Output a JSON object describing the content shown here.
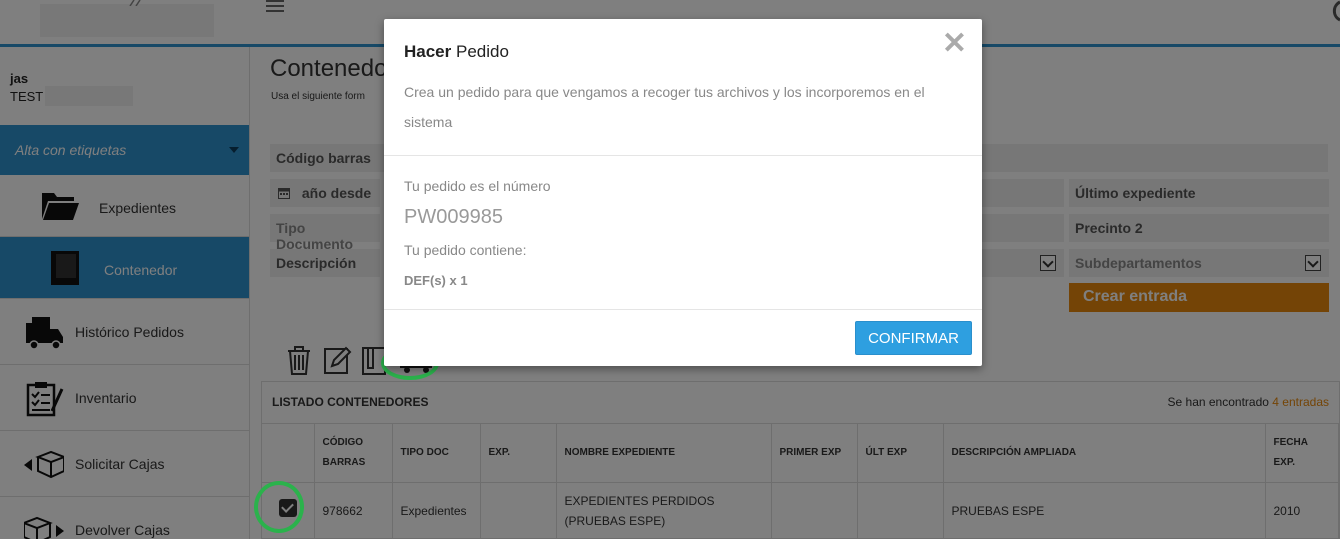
{
  "user": {
    "name": "jas",
    "org": "TEST"
  },
  "sidebar": {
    "section": "Alta con etiquetas",
    "sub_items": [
      {
        "label": "Expedientes",
        "icon": "folder-open-icon"
      },
      {
        "label": "Contenedor",
        "icon": "book-icon",
        "active": true
      }
    ],
    "items": [
      {
        "label": "Histórico Pedidos",
        "icon": "truck-icon"
      },
      {
        "label": "Inventario",
        "icon": "clipboard-icon"
      },
      {
        "label": "Solicitar Cajas",
        "icon": "box-arrow-left-icon"
      },
      {
        "label": "Devolver Cajas",
        "icon": "box-arrow-right-icon"
      }
    ]
  },
  "main": {
    "title": "Contenedo",
    "subtitle": "Usa el siguiente form",
    "form": {
      "codigo_barras": "Código barras",
      "anio_desde": "año desde",
      "ultimo_expediente": "Último expediente",
      "tipo_documento": "Tipo Documento",
      "precinto2": "Precinto 2",
      "descripcion": "Descripción",
      "subdepartamentos": "Subdepartamentos",
      "crear_entrada": "Crear entrada"
    },
    "list": {
      "title": "LISTADO CONTENEDORES",
      "count_prefix": "Se han encontrado",
      "count_value": "4 entradas",
      "columns": [
        "CÓDIGO BARRAS",
        "TIPO DOC",
        "EXP.",
        "NOMBRE EXPEDIENTE",
        "PRIMER EXP",
        "ÚLT EXP",
        "DESCRIPCIÓN AMPLIADA",
        "FECHA EXP."
      ],
      "rows": [
        {
          "codigo": "978662",
          "tipo": "Expedientes",
          "exp": "",
          "nombre": "EXPEDIENTES PERDIDOS (PRUEBAS ESPE)",
          "primer": "",
          "ult": "",
          "desc": "PRUEBAS ESPE",
          "fecha": "2010",
          "checked": true
        }
      ]
    }
  },
  "modal": {
    "title_bold": "Hacer",
    "title_rest": " Pedido",
    "close": "✕",
    "description": "Crea un pedido para que vengamos a recoger tus archivos y los incorporemos en el sistema",
    "order_label": "Tu pedido es el número",
    "order_number": "PW009985",
    "contains_label": "Tu pedido contiene:",
    "contains_items": "DEF(s) x 1",
    "confirm": "CONFIRMAR"
  },
  "colors": {
    "accent": "#2e92cf",
    "orange": "#e8890c",
    "highlight_ring": "#2bb24c"
  }
}
